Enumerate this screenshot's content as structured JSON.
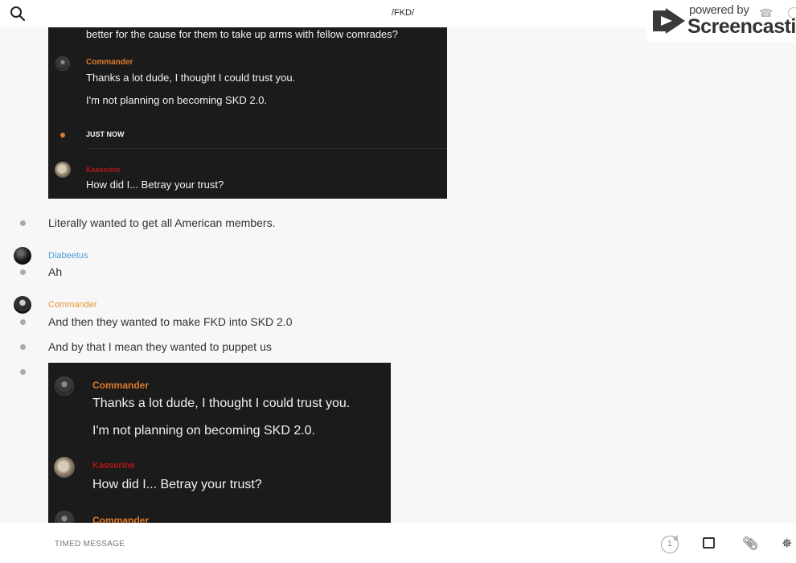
{
  "header": {
    "channel_title": "/FKD/",
    "search_icon": "search-icon",
    "phone_icon": "phone-icon",
    "info_icon": "info-icon"
  },
  "watermark": {
    "powered_by": "powered by",
    "brand": "Screencastify"
  },
  "embedded_image_1": {
    "top_line": "better for the cause for them to take up arms with fellow comrades?",
    "commander_name": "Commander",
    "commander_line1": "Thanks a lot dude, I thought I could trust you.",
    "commander_line2": "I'm not planning on becoming SKD 2.0.",
    "timestamp": "JUST NOW",
    "kasserine_name": "Kasserine",
    "kasserine_line": "How did I... Betray your trust?"
  },
  "messages": [
    {
      "text": "Literally wanted to get all American members."
    },
    {
      "author": "Diabeetus",
      "text": "Ah"
    },
    {
      "author": "Commander",
      "text": "And then they wanted to make FKD into SKD 2.0"
    },
    {
      "text": "And by that I mean they wanted to puppet us"
    }
  ],
  "embedded_image_2": {
    "commander_name": "Commander",
    "commander_line1": "Thanks a lot dude, I thought I could trust you.",
    "commander_line2": "I'm not planning on becoming SKD 2.0.",
    "kasserine_name": "Kasserine",
    "kasserine_line": "How did I... Betray your trust?",
    "commander_name_2": "Commander"
  },
  "composer": {
    "placeholder": "TIMED MESSAGE",
    "timer_value": "1",
    "timer_unit": "d"
  },
  "colors": {
    "accent_orange": "#e8952e",
    "author_blue": "#4a9fd8",
    "kasserine_red": "#b31818"
  }
}
